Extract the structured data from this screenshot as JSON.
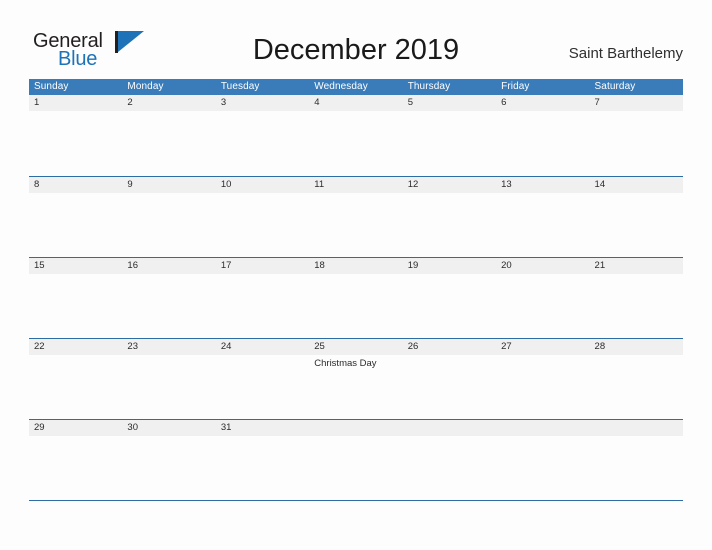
{
  "brand": {
    "name_part1": "General",
    "name_part2": "Blue",
    "logo_mark": "flag-triangle-icon",
    "accent_color": "#1d72b8"
  },
  "header": {
    "title": "December 2019",
    "location": "Saint Barthelemy"
  },
  "calendar": {
    "month": "December",
    "year": "2019",
    "header_bg_color": "#3a7cb9",
    "band_bg_color": "#f0f0f0",
    "rule_color": "#2e6da4",
    "day_headers": [
      "Sunday",
      "Monday",
      "Tuesday",
      "Wednesday",
      "Thursday",
      "Friday",
      "Saturday"
    ],
    "weeks": [
      {
        "days": [
          {
            "num": "1",
            "events": []
          },
          {
            "num": "2",
            "events": []
          },
          {
            "num": "3",
            "events": []
          },
          {
            "num": "4",
            "events": []
          },
          {
            "num": "5",
            "events": []
          },
          {
            "num": "6",
            "events": []
          },
          {
            "num": "7",
            "events": []
          }
        ]
      },
      {
        "days": [
          {
            "num": "8",
            "events": []
          },
          {
            "num": "9",
            "events": []
          },
          {
            "num": "10",
            "events": []
          },
          {
            "num": "11",
            "events": []
          },
          {
            "num": "12",
            "events": []
          },
          {
            "num": "13",
            "events": []
          },
          {
            "num": "14",
            "events": []
          }
        ]
      },
      {
        "days": [
          {
            "num": "15",
            "events": []
          },
          {
            "num": "16",
            "events": []
          },
          {
            "num": "17",
            "events": []
          },
          {
            "num": "18",
            "events": []
          },
          {
            "num": "19",
            "events": []
          },
          {
            "num": "20",
            "events": []
          },
          {
            "num": "21",
            "events": []
          }
        ]
      },
      {
        "days": [
          {
            "num": "22",
            "events": []
          },
          {
            "num": "23",
            "events": []
          },
          {
            "num": "24",
            "events": []
          },
          {
            "num": "25",
            "events": [
              "Christmas Day"
            ]
          },
          {
            "num": "26",
            "events": []
          },
          {
            "num": "27",
            "events": []
          },
          {
            "num": "28",
            "events": []
          }
        ]
      },
      {
        "days": [
          {
            "num": "29",
            "events": []
          },
          {
            "num": "30",
            "events": []
          },
          {
            "num": "31",
            "events": []
          },
          {
            "num": "",
            "events": []
          },
          {
            "num": "",
            "events": []
          },
          {
            "num": "",
            "events": []
          },
          {
            "num": "",
            "events": []
          }
        ]
      }
    ]
  }
}
